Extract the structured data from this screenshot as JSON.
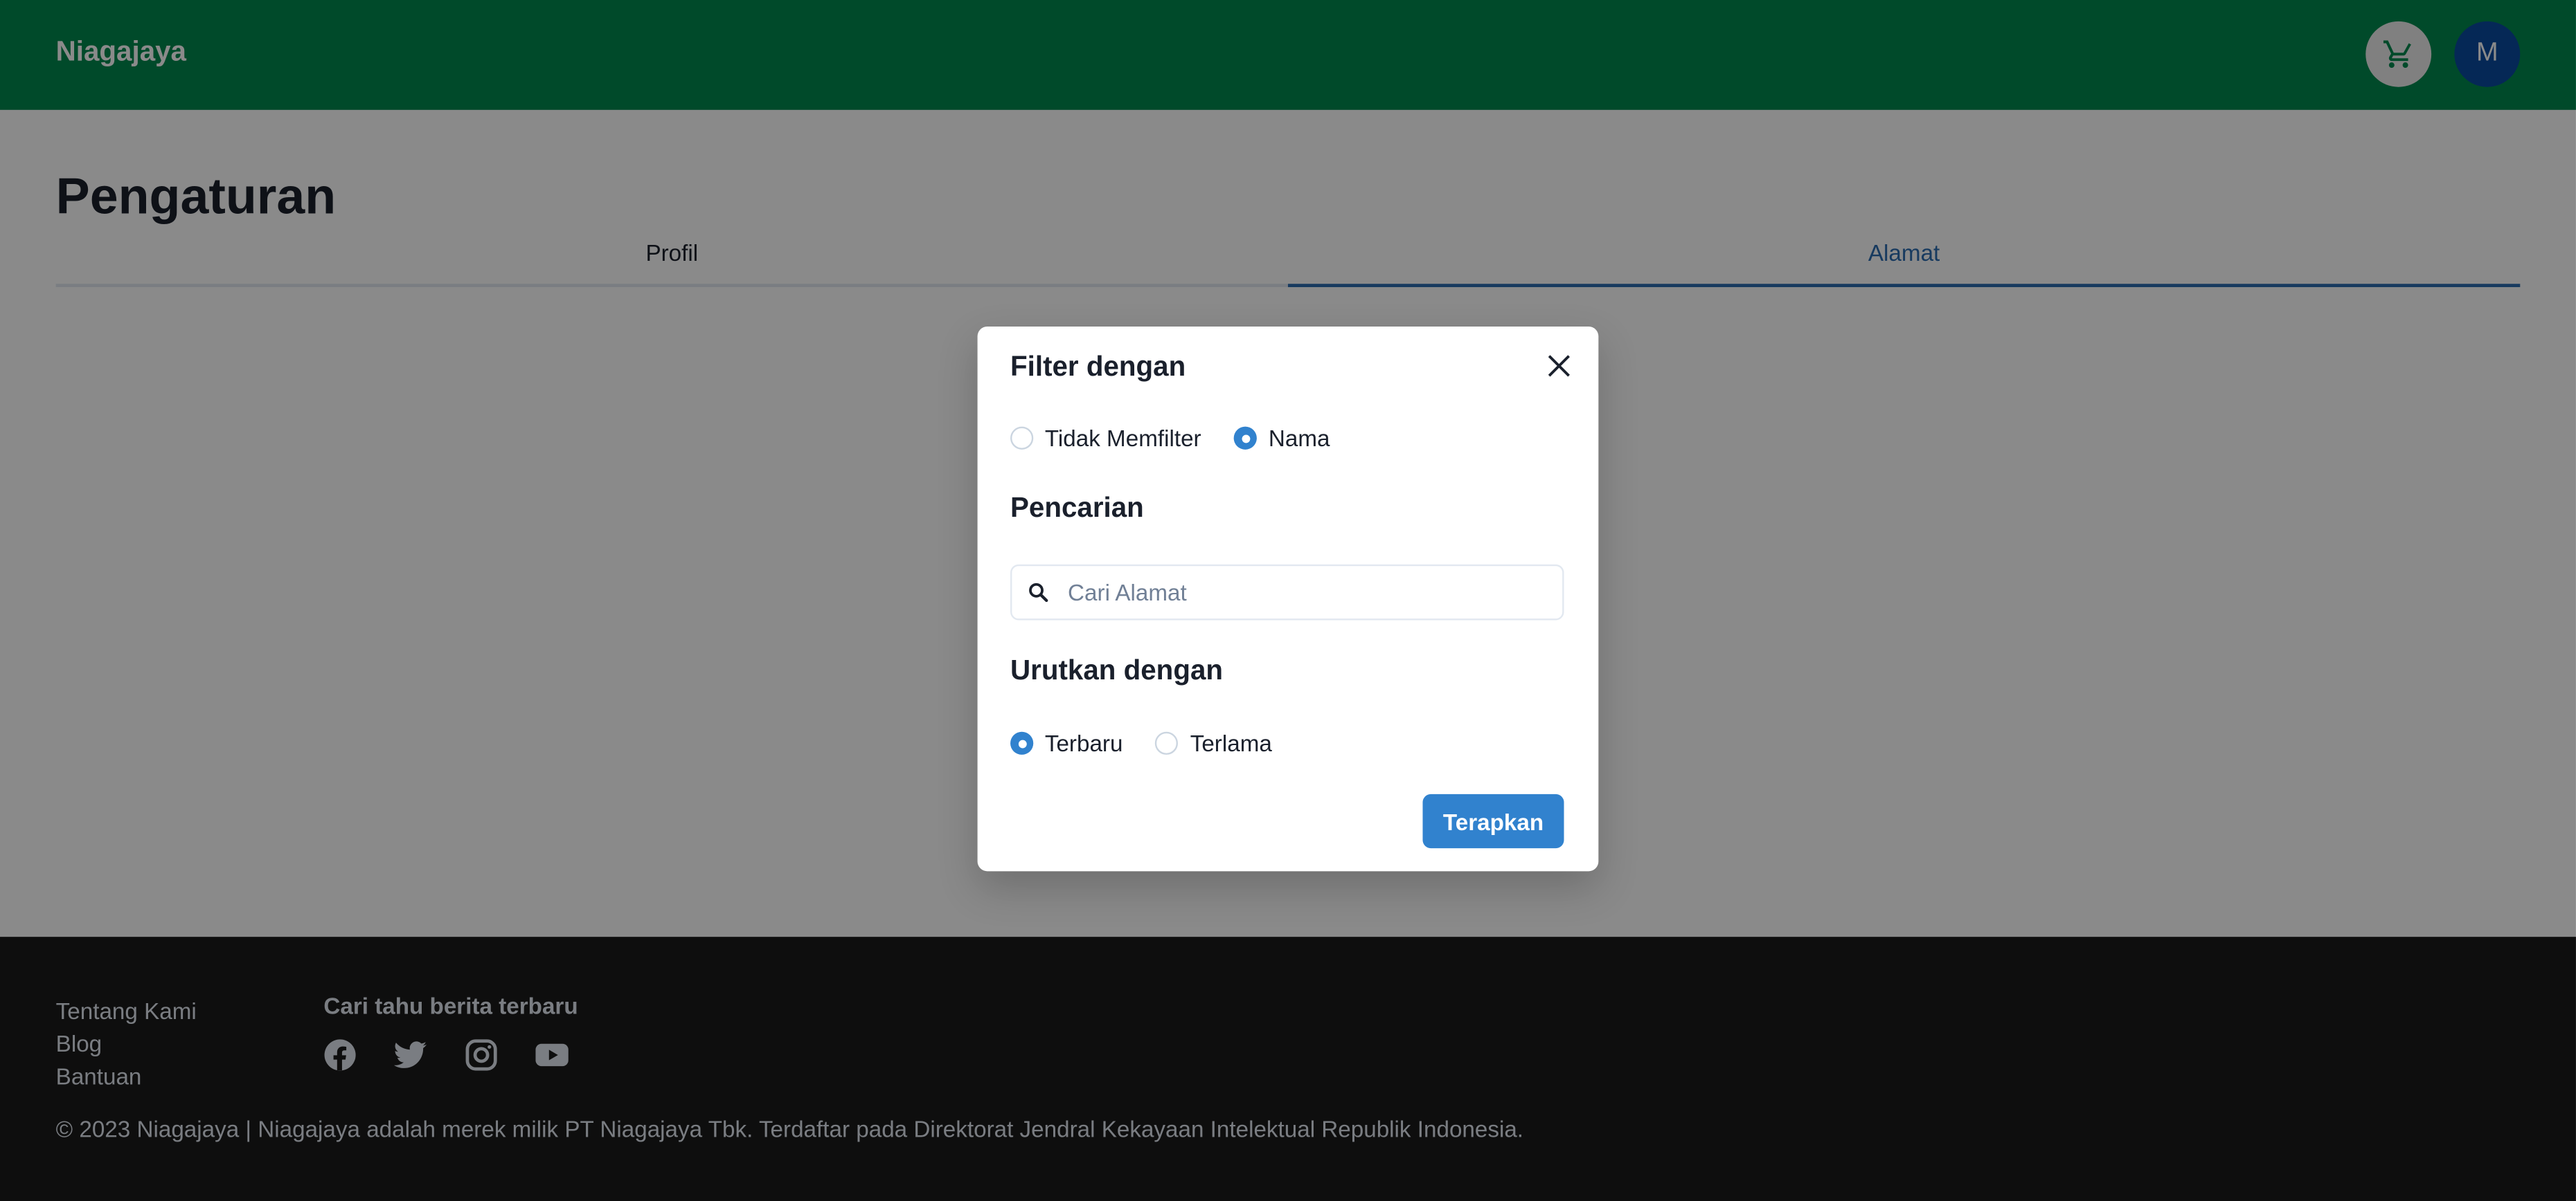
{
  "header": {
    "brand": "Niagajaya",
    "avatar_initial": "M"
  },
  "page": {
    "title": "Pengaturan",
    "tabs": [
      {
        "label": "Profil",
        "active": false
      },
      {
        "label": "Alamat",
        "active": true
      }
    ]
  },
  "modal": {
    "filter_title": "Filter dengan",
    "filter_options": [
      {
        "label": "Tidak Memfilter",
        "checked": false
      },
      {
        "label": "Nama",
        "checked": true
      }
    ],
    "search_title": "Pencarian",
    "search_placeholder": "Cari Alamat",
    "search_value": "",
    "sort_title": "Urutkan dengan",
    "sort_options": [
      {
        "label": "Terbaru",
        "checked": true
      },
      {
        "label": "Terlama",
        "checked": false
      }
    ],
    "apply_label": "Terapkan"
  },
  "footer": {
    "links": [
      "Tentang Kami",
      "Blog",
      "Bantuan"
    ],
    "news_title": "Cari tahu berita terbaru",
    "socials": [
      "facebook-icon",
      "twitter-icon",
      "instagram-icon",
      "youtube-icon"
    ],
    "copyright": "© 2023 Niagajaya | Niagajaya adalah merek milik PT Niagajaya Tbk. Terdaftar pada Direktorat Jendral Kekayaan Intelektual Republik Indonesia."
  },
  "colors": {
    "header_bg": "#00894f",
    "accent": "#3182ce",
    "tab_active": "#2b6cb0",
    "footer_bg": "#1a1a1a",
    "avatar_bg": "#0a4aa0"
  }
}
